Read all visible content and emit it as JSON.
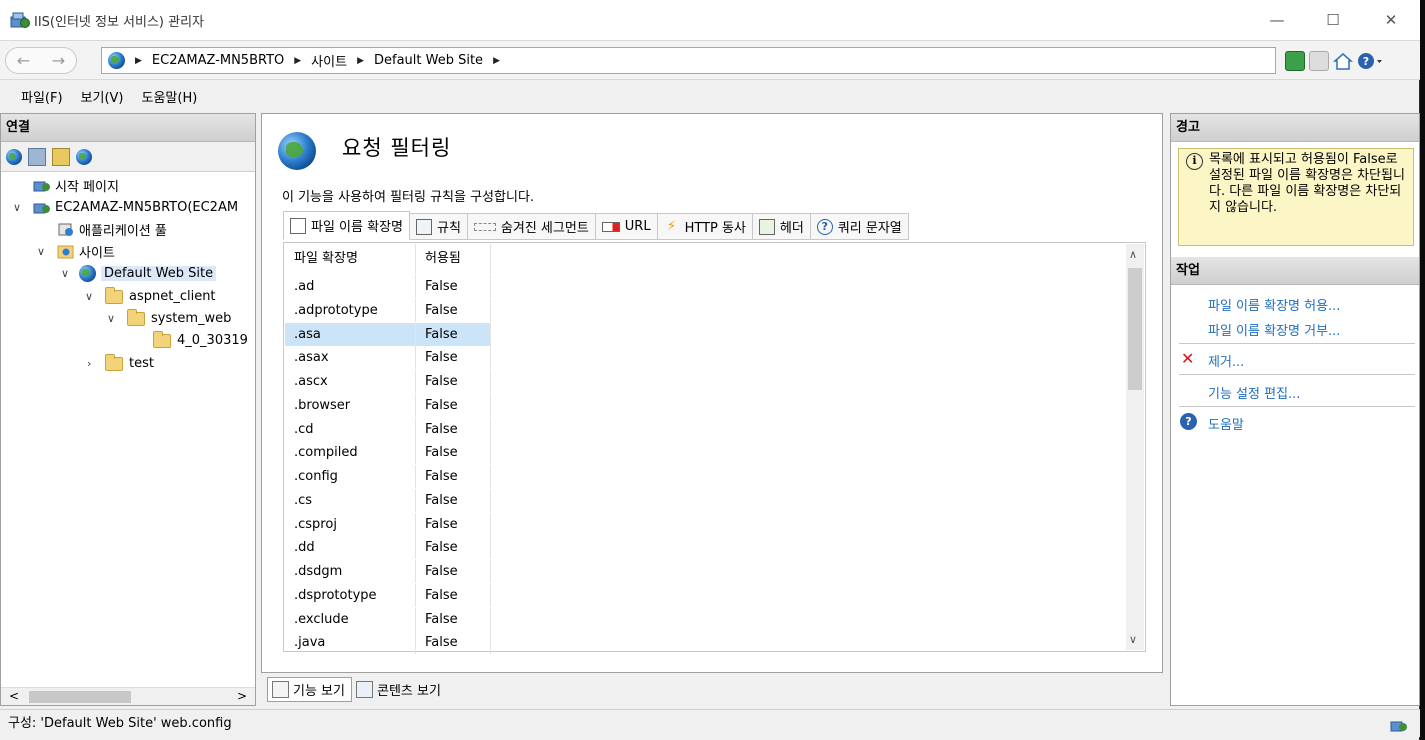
{
  "window": {
    "title": "IIS(인터넷 정보 서비스) 관리자",
    "minimize": "—",
    "maximize": "☐",
    "close": "✕"
  },
  "address": {
    "back": "←",
    "forward": "→",
    "crumbs": [
      "EC2AMAZ-MN5BRTO",
      "사이트",
      "Default Web Site"
    ],
    "separator": "▶"
  },
  "menu": {
    "file": "파일(F)",
    "view": "보기(V)",
    "help": "도움말(H)"
  },
  "connections": {
    "header": "연결",
    "tree": {
      "start_page": "시작 페이지",
      "server": "EC2AMAZ-MN5BRTO(EC2AM",
      "app_pools": "애플리케이션 풀",
      "sites": "사이트",
      "default_site": "Default Web Site",
      "aspnet_client": "aspnet_client",
      "system_web": "system_web",
      "version_folder": "4_0_30319",
      "test": "test"
    },
    "scroll_left": "<",
    "scroll_right": ">"
  },
  "feature": {
    "title": "요청 필터링",
    "description": "이 기능을 사용하여 필터링 규칙을 구성합니다.",
    "tabs": [
      {
        "label": "파일 이름 확장명",
        "icon": "file-extension-icon"
      },
      {
        "label": "규칙",
        "icon": "rules-icon"
      },
      {
        "label": "숨겨진 세그먼트",
        "icon": "hidden-segments-icon"
      },
      {
        "label": "URL",
        "icon": "url-icon"
      },
      {
        "label": "HTTP 동사",
        "icon": "http-verbs-icon"
      },
      {
        "label": "헤더",
        "icon": "headers-icon"
      },
      {
        "label": "쿼리 문자열",
        "icon": "query-string-icon"
      }
    ],
    "columns": [
      "파일 확장명",
      "허용됨"
    ],
    "rows": [
      [
        ".ad",
        "False"
      ],
      [
        ".adprototype",
        "False"
      ],
      [
        ".asa",
        "False"
      ],
      [
        ".asax",
        "False"
      ],
      [
        ".ascx",
        "False"
      ],
      [
        ".browser",
        "False"
      ],
      [
        ".cd",
        "False"
      ],
      [
        ".compiled",
        "False"
      ],
      [
        ".config",
        "False"
      ],
      [
        ".cs",
        "False"
      ],
      [
        ".csproj",
        "False"
      ],
      [
        ".dd",
        "False"
      ],
      [
        ".dsdgm",
        "False"
      ],
      [
        ".dsprototype",
        "False"
      ],
      [
        ".exclude",
        "False"
      ],
      [
        ".java",
        "False"
      ]
    ],
    "selected_row": 2
  },
  "view_tabs": {
    "features": "기능 보기",
    "content": "콘텐츠 보기"
  },
  "alerts": {
    "header": "경고",
    "message": "목록에 표시되고 허용됨이 False로 설정된 파일 이름 확장명은 차단됩니다. 다른 파일 이름 확장명은 차단되지 않습니다."
  },
  "actions": {
    "header": "작업",
    "allow": "파일 이름 확장명 허용...",
    "deny": "파일 이름 확장명 거부...",
    "remove": "제거...",
    "edit_settings": "기능 설정 편집...",
    "help": "도움말"
  },
  "status": {
    "text": "구성: 'Default Web Site' web.config"
  },
  "colors": {
    "accent_link": "#1e6fc0",
    "selection": "#cce4f7",
    "alert_bg": "#fcf6c6"
  }
}
